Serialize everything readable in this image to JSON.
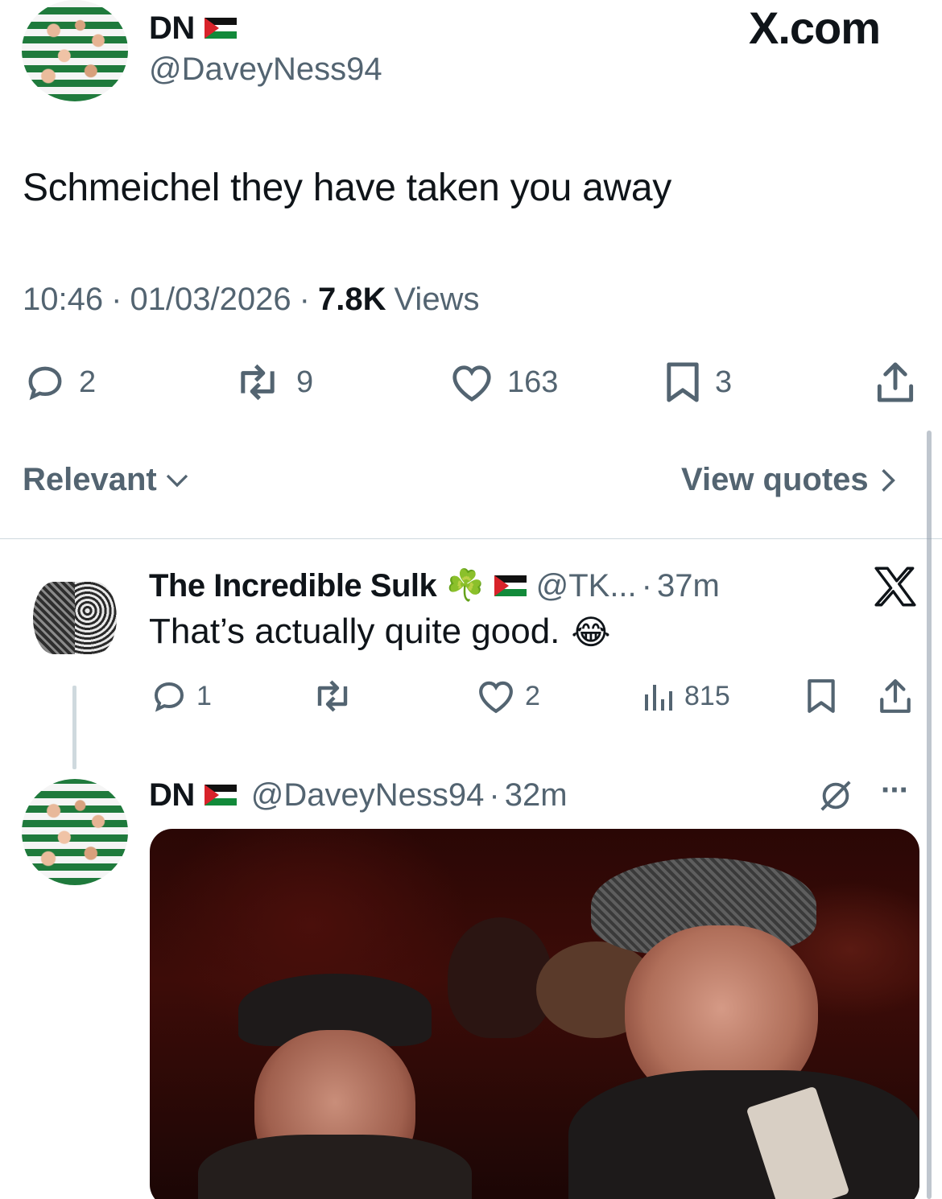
{
  "tweet": {
    "author_name": "DN",
    "handle": "@DaveyNess94",
    "site_label": "X.com",
    "text": "Schmeichel they have taken you away",
    "time": "10:46",
    "sep1": "·",
    "date": "01/03/2026",
    "sep2": "·",
    "views_count": "7.8K",
    "views_label": "Views",
    "replies": "2",
    "reposts": "9",
    "likes": "163",
    "bookmarks": "3"
  },
  "replies_bar": {
    "sort_label": "Relevant",
    "view_quotes_label": "View quotes"
  },
  "reply1": {
    "name": "The Incredible Sulk",
    "clover": "☘️",
    "handle": "@TK...",
    "sep": "·",
    "time": "37m",
    "text": "That’s actually quite good.",
    "emoji": "😂",
    "replies": "1",
    "likes": "2",
    "views": "815"
  },
  "reply2": {
    "name": "DN",
    "handle": "@DaveyNess94",
    "sep": "·",
    "time": "32m",
    "more": "···"
  },
  "colors": {
    "text": "#0f1419",
    "muted": "#536471",
    "divider": "#cfd9de"
  }
}
